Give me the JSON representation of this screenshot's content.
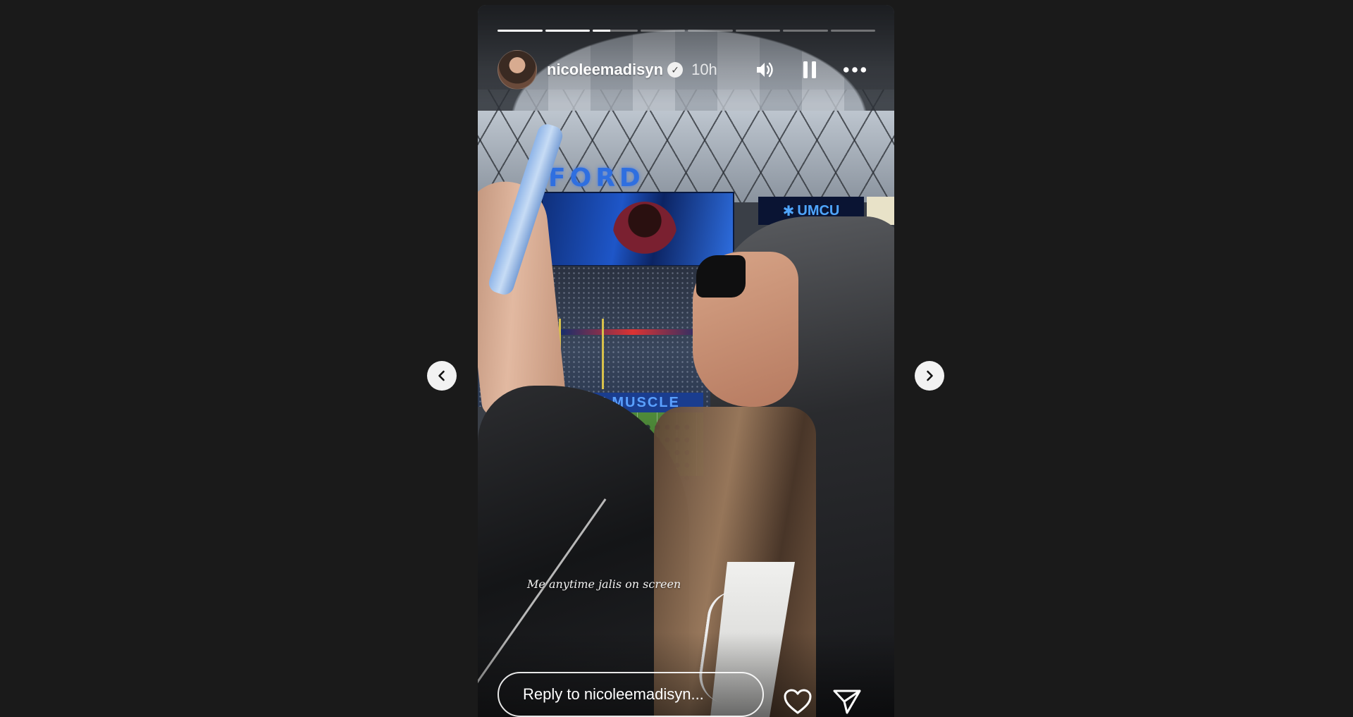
{
  "story": {
    "username": "nicoleemadisyn",
    "verified": true,
    "time_ago": "10h",
    "caption": "Me anytime jalis on screen",
    "progress": {
      "segments_total": 8,
      "current_segment_index": 2,
      "current_segment_fill": 0.4
    },
    "scene_text": {
      "stadium_sign": "FORD FIELD",
      "sponsor": "UMCU",
      "end_zone": "MOTOR CITY MUSCLE"
    }
  },
  "controls": {
    "sound_icon": "speaker-icon",
    "pause_icon": "pause-icon",
    "more_icon": "more-icon"
  },
  "reply": {
    "placeholder": "Reply to nicoleemadisyn..."
  },
  "actions": {
    "like_icon": "heart-icon",
    "share_icon": "send-icon"
  },
  "navigation": {
    "prev_icon": "chevron-left-icon",
    "next_icon": "chevron-right-icon"
  },
  "colors": {
    "background": "#1a1a1a",
    "progress_active": "#ffffff",
    "progress_inactive": "rgba(255,255,255,0.35)"
  }
}
